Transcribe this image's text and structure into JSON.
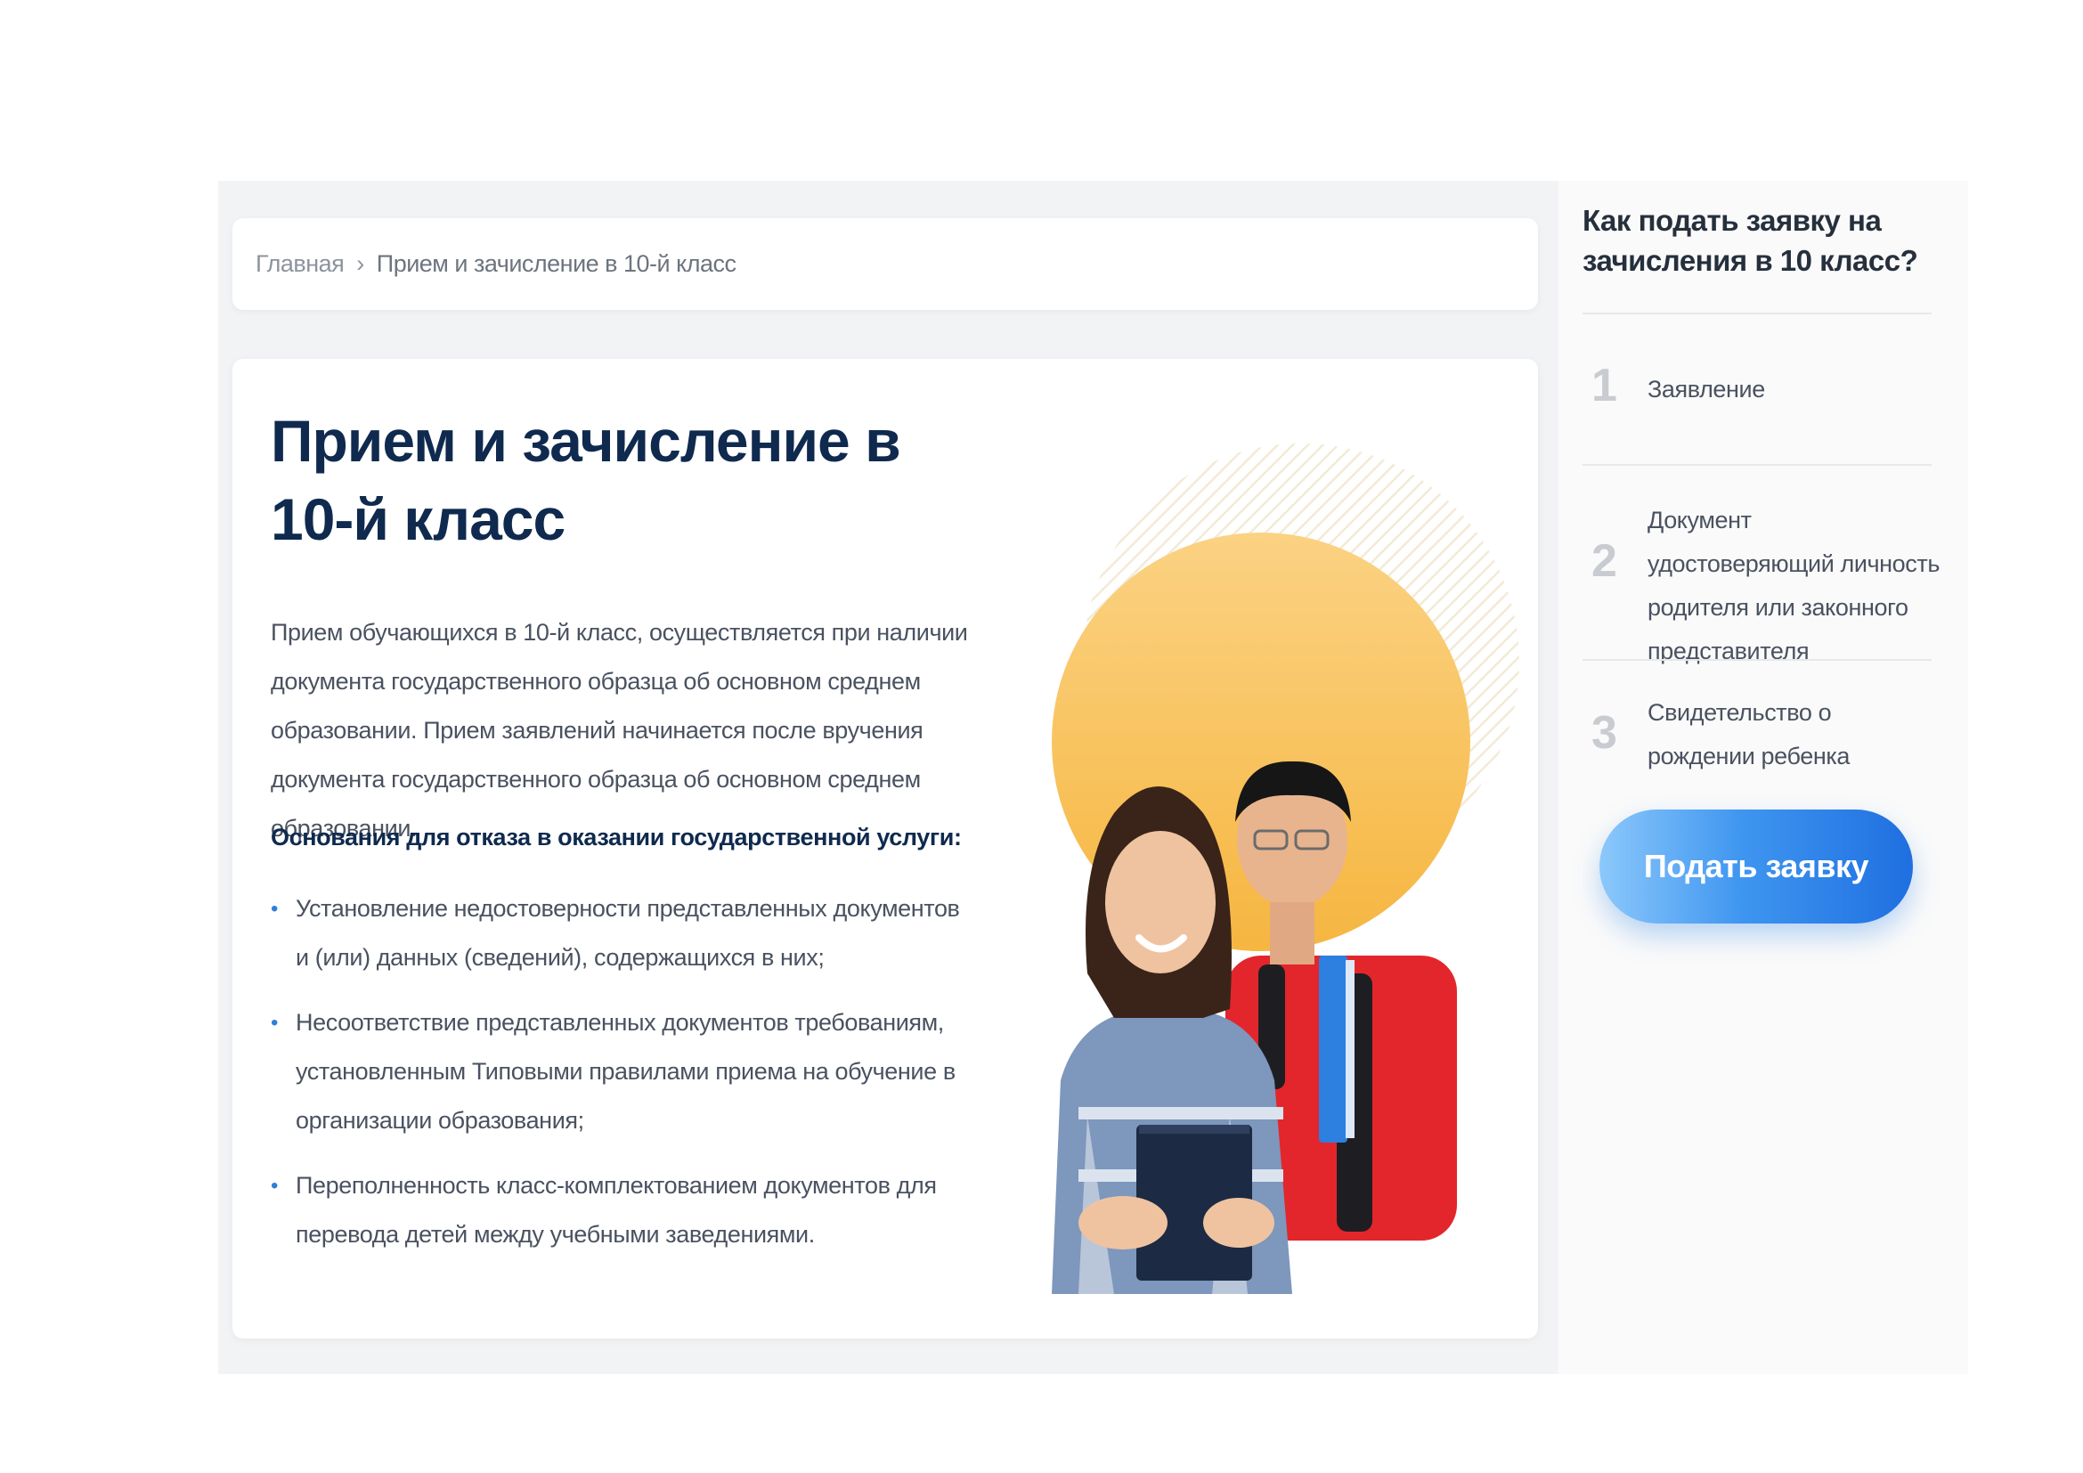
{
  "breadcrumb": {
    "home": "Главная",
    "separator": "›",
    "current": "Прием и зачисление в 10-й класс"
  },
  "main": {
    "title": "Прием и зачисление в 10-й класс",
    "intro": "Прием обучающихся в 10-й класс, осуществляется при наличии документа государственного образца об основном среднем образовании. Прием заявлений начинается после вручения документа государственного образца об основном среднем образовании.",
    "reasons_title": "Основания для отказа в оказании государственной услуги:",
    "reasons": [
      "Установление недостоверности представленных документов и (или) данных (сведений), содержащихся в них;",
      "Несоответствие представленных документов требованиям, установленным Типовыми правилами приема на обучение в организации образования;",
      "Переполненность класс-комплектованием документов для перевода детей между учебными заведениями."
    ],
    "bullet": "•"
  },
  "sidebar": {
    "title": "Как подать заявку на зачисления в 10 класс?",
    "steps": [
      {
        "num": "1",
        "text": "Заявление"
      },
      {
        "num": "2",
        "text": "Документ удостоверяющий личность родителя или законного представителя"
      },
      {
        "num": "3",
        "text": "Свидетельство о рождении ребенка"
      }
    ],
    "button": "Подать заявку"
  },
  "colors": {
    "title": "#0f2a4e",
    "accent": "#2f7fd8",
    "button_start": "#8cc8fb",
    "button_end": "#1f6fe0",
    "circle": "#fbc15a"
  }
}
